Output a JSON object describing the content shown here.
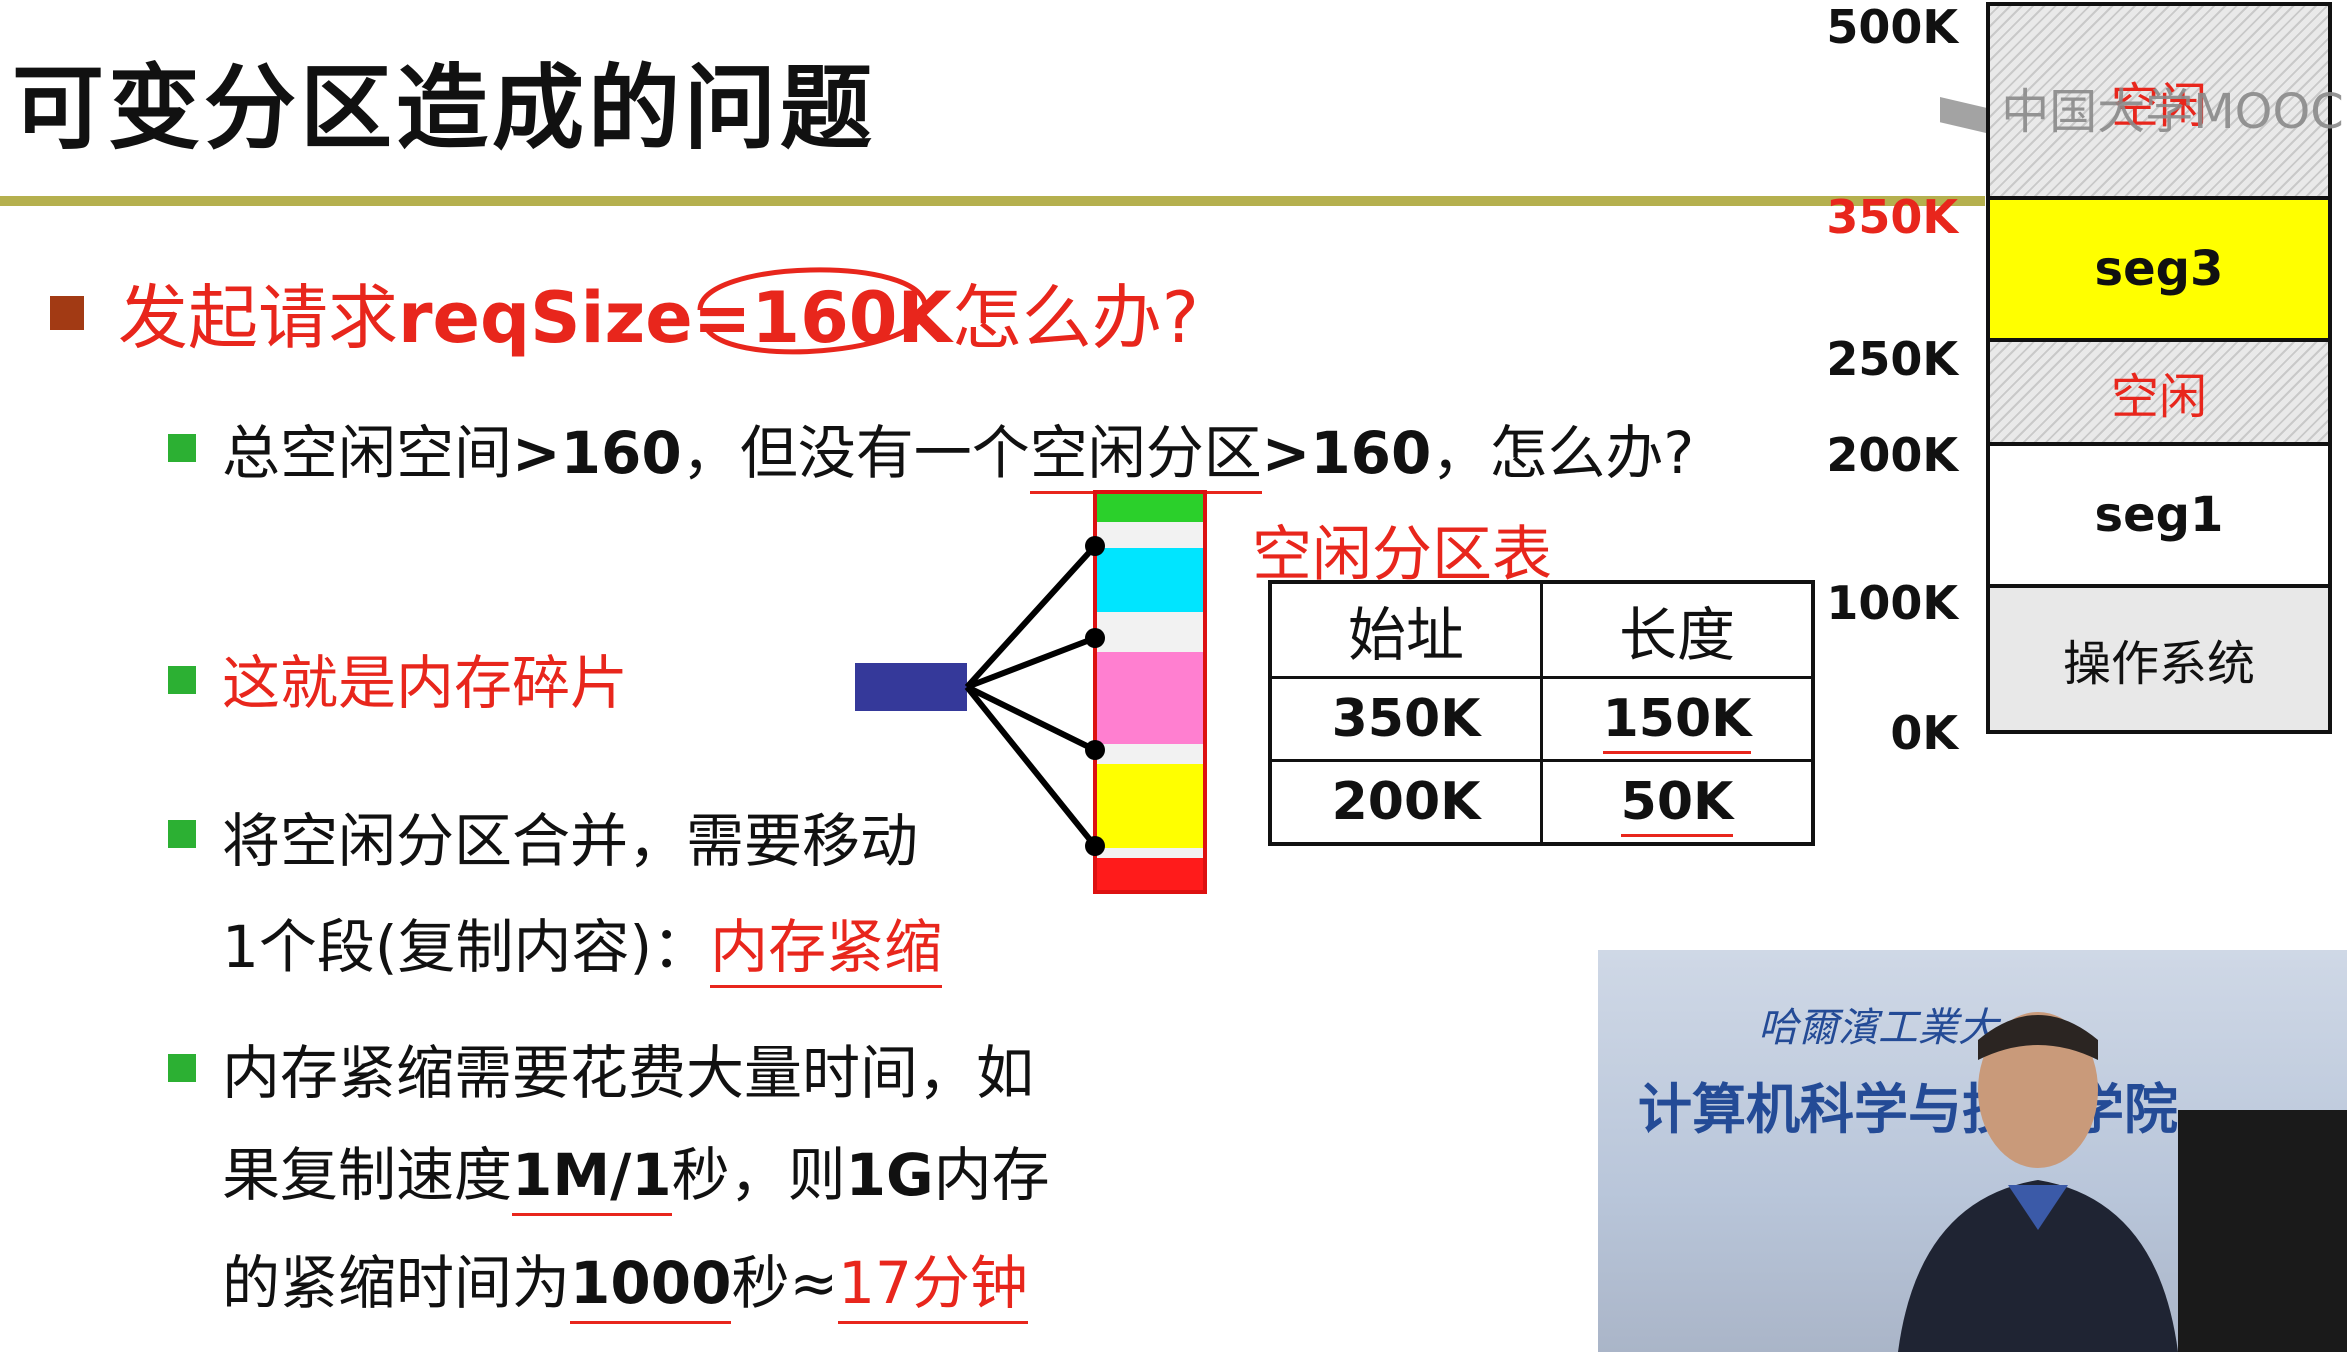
{
  "slide": {
    "title": "可变分区造成的问题",
    "main_question_prefix": "发起请求",
    "main_question_req": "reqSize=160K",
    "main_question_suffix": "怎么办?",
    "bullets": {
      "b1_a": "总空闲空间",
      "b1_b": ">160",
      "b1_c": "，但没有一个",
      "b1_d": "空闲分区",
      "b1_e": ">160",
      "b1_f": "，怎么办?",
      "b2": "这就是内存碎片",
      "b3_line1": "将空闲分区合并，需要移动",
      "b3_line2_a": "1个段(复制内容)：",
      "b3_line2_b": "内存紧缩",
      "b4_line1": "内存紧缩需要花费大量时间，如",
      "b4_line2_a": "果复制速度",
      "b4_line2_b": "1M/1",
      "b4_line2_c": "秒，则",
      "b4_line2_d": "1G",
      "b4_line2_e": "内存",
      "b4_line3_a": "的紧缩时间为",
      "b4_line3_b": "1000",
      "b4_line3_c": "秒≈",
      "b4_line3_d": "17分钟"
    }
  },
  "partition_table": {
    "title": "空闲分区表",
    "headers": [
      "始址",
      "长度"
    ],
    "rows": [
      [
        "350K",
        "150K"
      ],
      [
        "200K",
        "50K"
      ]
    ]
  },
  "memory_map": {
    "labels": [
      "500K",
      "350K",
      "250K",
      "200K",
      "100K",
      "0K"
    ],
    "segments": {
      "free_top": "空闲",
      "seg3": "seg3",
      "free_mid": "空闲",
      "seg1": "seg1",
      "os": "操作系统"
    }
  },
  "watermark": "中国大学MOOC",
  "video": {
    "sign_line1": "哈爾濱工業大",
    "sign_line2": "计算机科学与技术学院"
  },
  "colors": {
    "accent_red": "#e8261c",
    "bullet_green": "#2cb033",
    "title_rule": "#b5b04e",
    "seg3_yellow": "#ffff00"
  }
}
